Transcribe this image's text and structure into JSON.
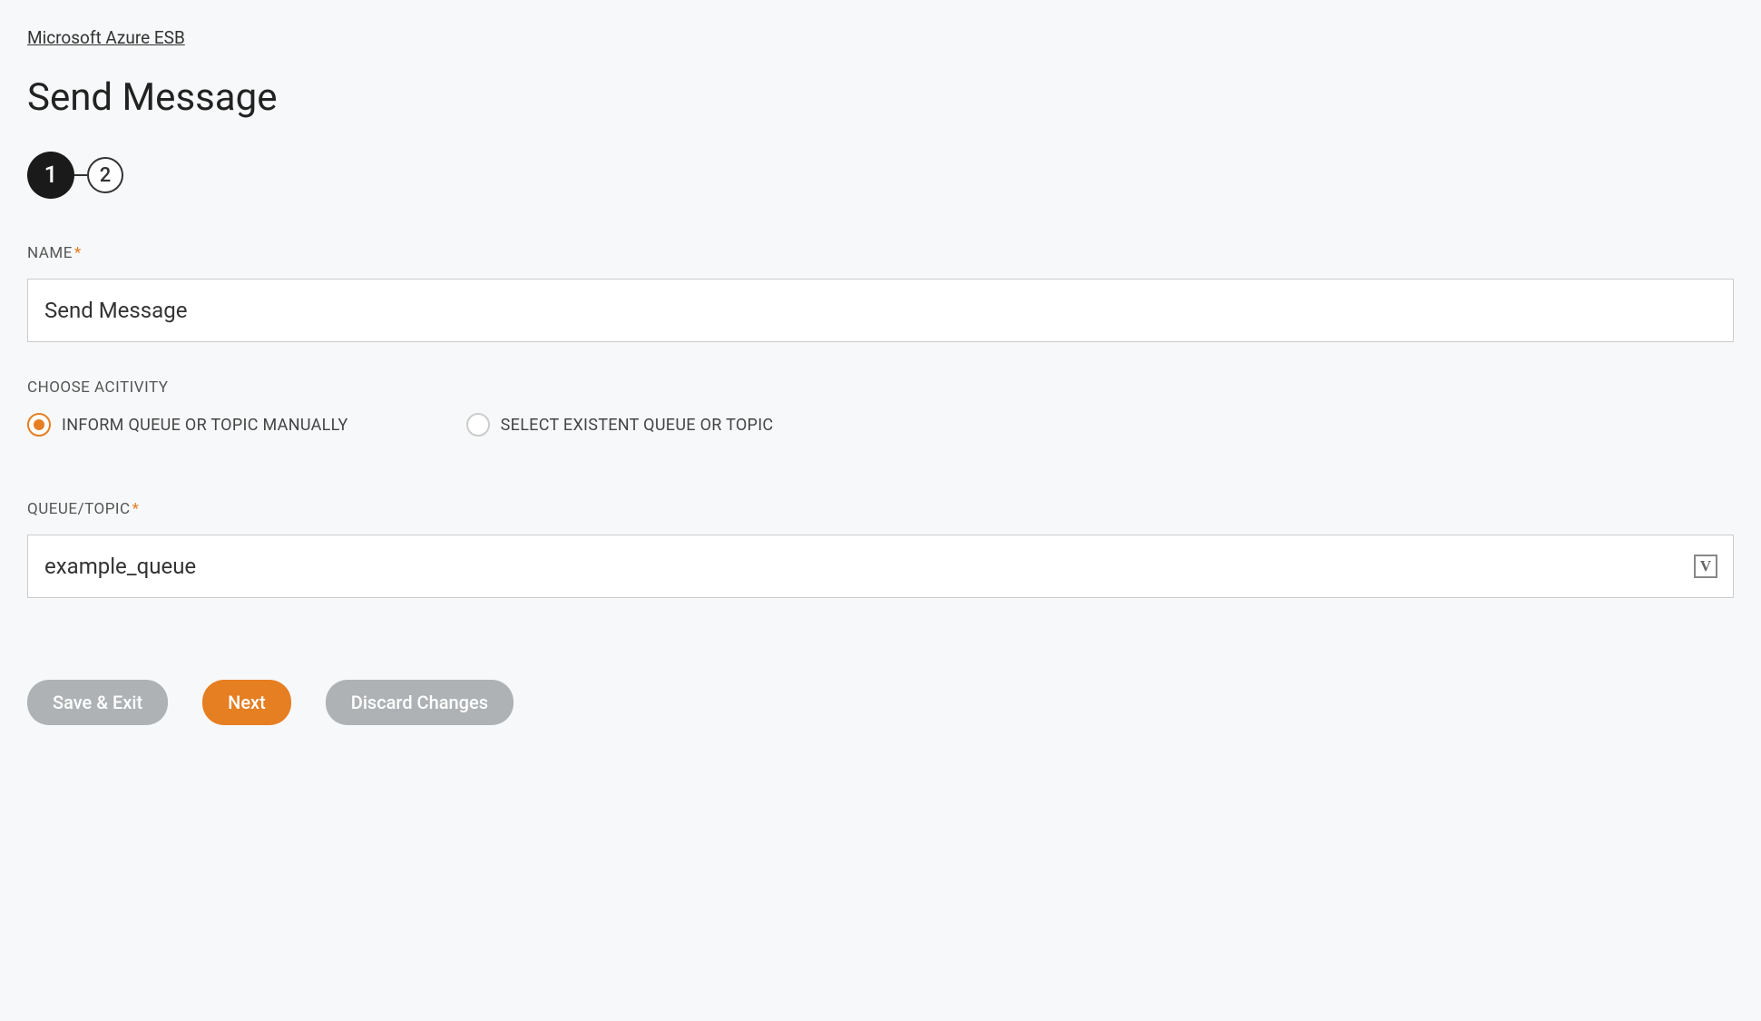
{
  "breadcrumb": {
    "label": "Microsoft Azure ESB"
  },
  "page": {
    "title": "Send Message"
  },
  "stepper": {
    "step1": "1",
    "step2": "2"
  },
  "form": {
    "name": {
      "label": "NAME",
      "value": "Send Message"
    },
    "activity": {
      "label": "CHOOSE ACITIVITY",
      "options": {
        "manual": "INFORM QUEUE OR TOPIC MANUALLY",
        "select": "SELECT EXISTENT QUEUE OR TOPIC"
      }
    },
    "queueTopic": {
      "label": "QUEUE/TOPIC",
      "value": "example_queue"
    }
  },
  "buttons": {
    "saveExit": "Save & Exit",
    "next": "Next",
    "discard": "Discard Changes"
  },
  "asterisk": "*",
  "suffixIcon": "V"
}
